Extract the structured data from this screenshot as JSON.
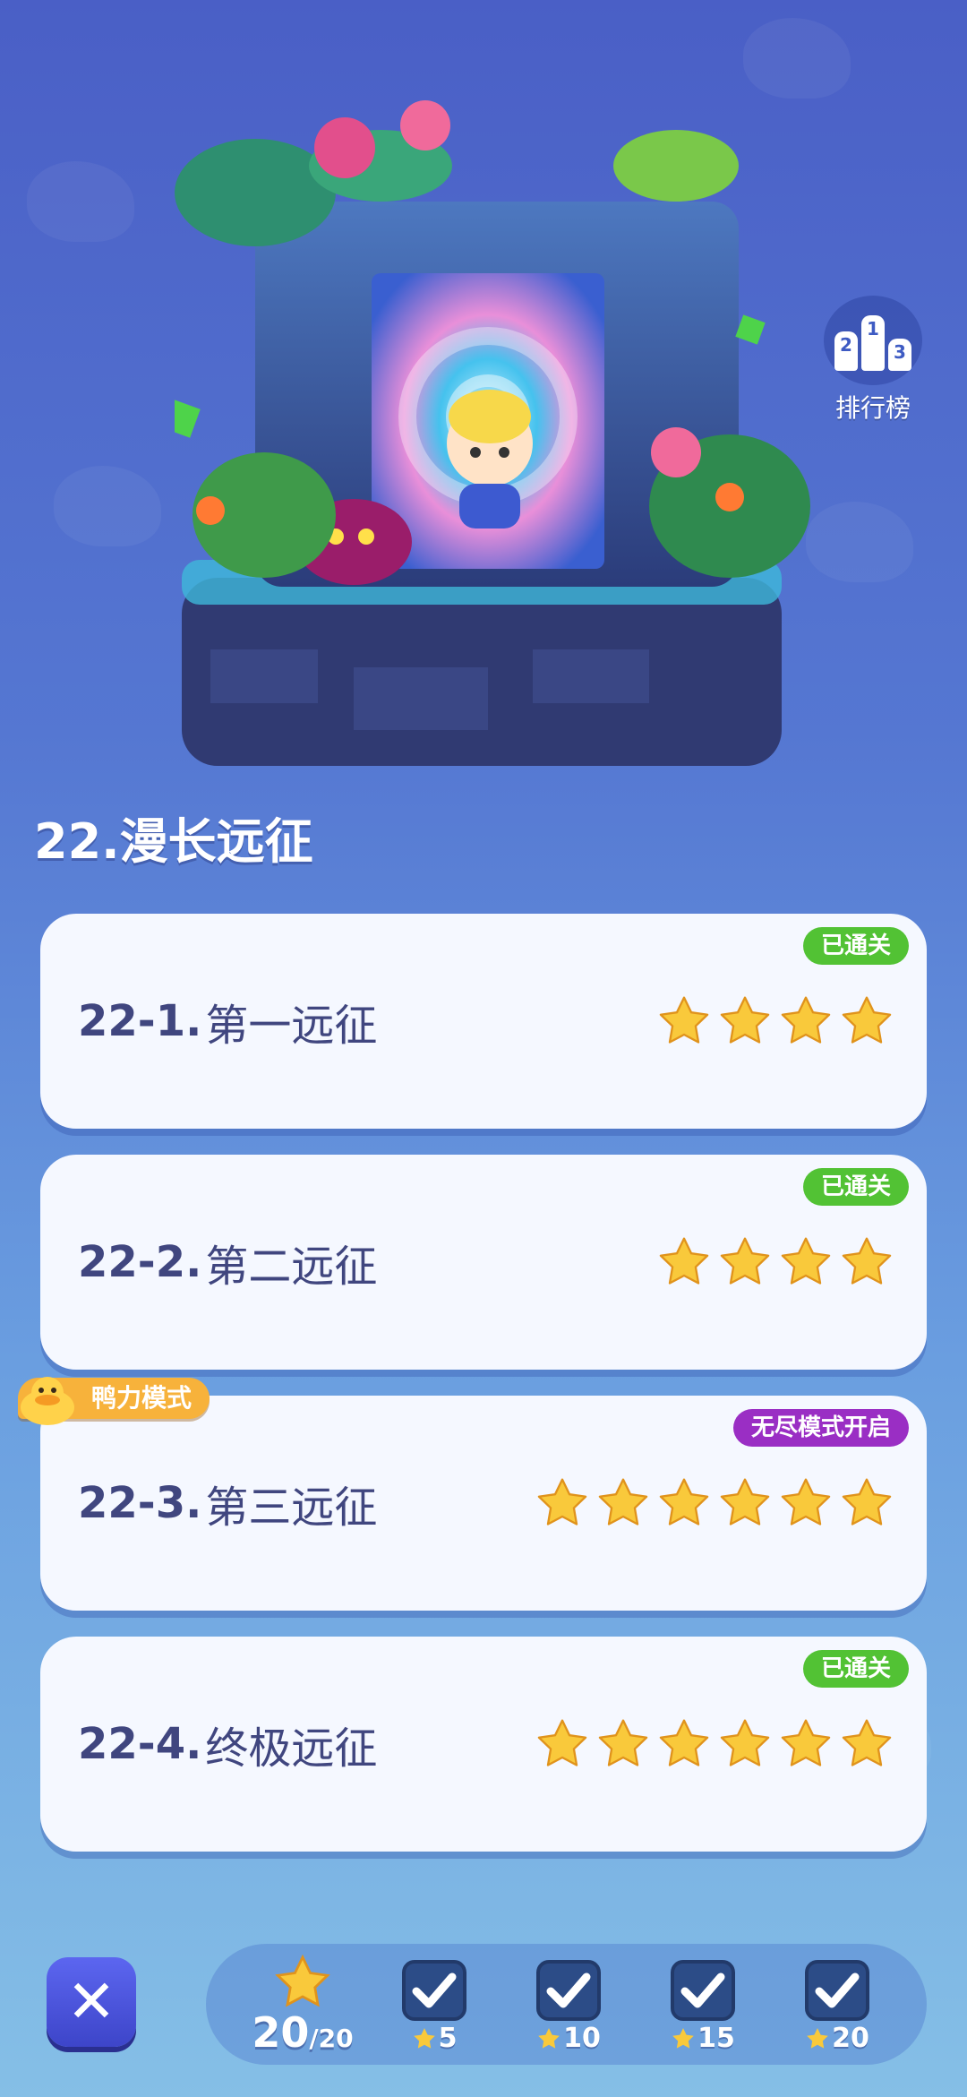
{
  "leaderboard": {
    "label": "排行榜",
    "podium": [
      "2",
      "1",
      "3"
    ]
  },
  "chapter": {
    "title": "22.漫长远征"
  },
  "levels": [
    {
      "number": "22-1.",
      "name": "第一远征",
      "badge": "已通关",
      "badge_color": "#52c234",
      "stars_earned": 4,
      "stars_total": 4
    },
    {
      "number": "22-2.",
      "name": "第二远征",
      "badge": "已通关",
      "badge_color": "#52c234",
      "stars_earned": 4,
      "stars_total": 4
    },
    {
      "number": "22-3.",
      "name": "第三远征",
      "badge": "无尽模式开启",
      "badge_color": "#9a2ec4",
      "tag": "鸭力模式",
      "stars_earned": 6,
      "stars_total": 6
    },
    {
      "number": "22-4.",
      "name": "终极远征",
      "badge": "已通关",
      "badge_color": "#52c234",
      "stars_earned": 6,
      "stars_total": 6
    }
  ],
  "rewards": {
    "collected": "20",
    "max": "/20",
    "milestones": [
      {
        "label": "5",
        "claimed": true
      },
      {
        "label": "10",
        "claimed": true
      },
      {
        "label": "15",
        "claimed": true
      },
      {
        "label": "20",
        "claimed": true
      }
    ]
  },
  "colors": {
    "star": "#f9c93b",
    "card_text": "#40467f",
    "close_button": "#4a53df"
  }
}
